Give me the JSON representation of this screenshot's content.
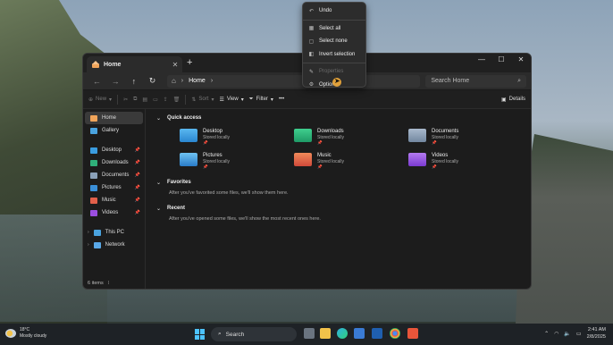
{
  "window": {
    "tab_title": "Home",
    "new_tab": "+",
    "controls": {
      "minimize": "—",
      "maximize": "☐",
      "close": "✕"
    }
  },
  "address": {
    "back": "←",
    "forward": "→",
    "up": "↑",
    "refresh": "↻",
    "location": "Home",
    "search_placeholder": "Search Home"
  },
  "toolbar": {
    "new_label": "New",
    "sort_label": "Sort",
    "view_label": "View",
    "filter_label": "Filter",
    "more_label": "•••",
    "details_label": "Details"
  },
  "sidebar": {
    "top": [
      {
        "label": "Home"
      },
      {
        "label": "Gallery"
      }
    ],
    "pinned": [
      {
        "label": "Desktop"
      },
      {
        "label": "Downloads"
      },
      {
        "label": "Documents"
      },
      {
        "label": "Pictures"
      },
      {
        "label": "Music"
      },
      {
        "label": "Videos"
      }
    ],
    "bottom": [
      {
        "label": "This PC"
      },
      {
        "label": "Network"
      }
    ]
  },
  "main": {
    "quick_access": {
      "title": "Quick access",
      "items": [
        {
          "name": "Desktop",
          "sub": "Stored locally"
        },
        {
          "name": "Downloads",
          "sub": "Stored locally"
        },
        {
          "name": "Documents",
          "sub": "Stored locally"
        },
        {
          "name": "Pictures",
          "sub": "Stored locally"
        },
        {
          "name": "Music",
          "sub": "Stored locally"
        },
        {
          "name": "Videos",
          "sub": "Stored locally"
        }
      ]
    },
    "favorites": {
      "title": "Favorites",
      "message": "After you've favorited some files, we'll show them here."
    },
    "recent": {
      "title": "Recent",
      "message": "After you've opened some files, we'll show the most recent ones here."
    }
  },
  "status": {
    "count": "6 items"
  },
  "menu": {
    "undo": "Undo",
    "select_all": "Select all",
    "select_none": "Select none",
    "invert": "Invert selection",
    "properties": "Properties",
    "options": "Options"
  },
  "taskbar": {
    "temp": "18°C",
    "weather": "Mostly cloudy",
    "search": "Search",
    "time": "2:41 AM",
    "date": "2/8/2025"
  },
  "colors": {
    "accent": "#4cc2ff",
    "menu_bg": "#2c2c2c",
    "window_bg": "#1c1c1c"
  }
}
